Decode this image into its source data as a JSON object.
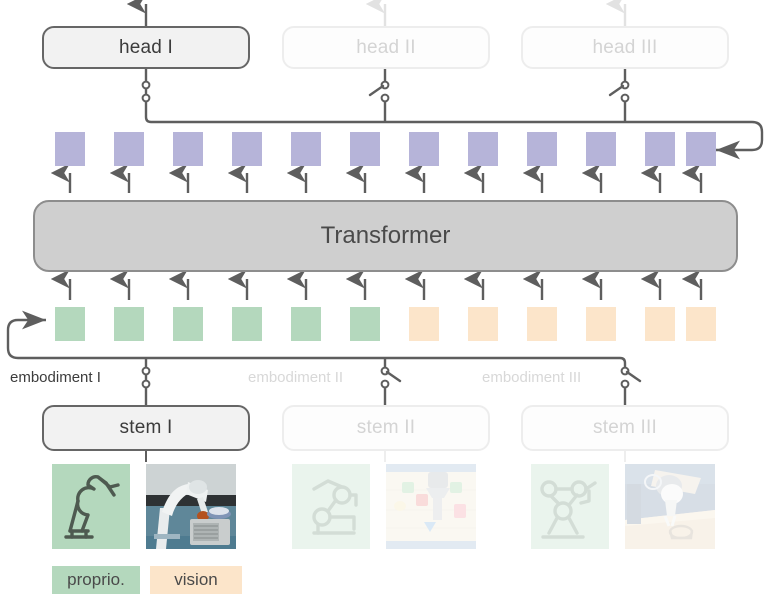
{
  "diagram": {
    "title_hidden": "",
    "core": {
      "label": "Transformer"
    },
    "heads": [
      {
        "label": "head I",
        "state": "active",
        "switch": "closed"
      },
      {
        "label": "head II",
        "state": "inactive",
        "switch": "open"
      },
      {
        "label": "head III",
        "state": "inactive",
        "switch": "open"
      }
    ],
    "stems": [
      {
        "label": "stem I",
        "state": "active",
        "switch": "closed"
      },
      {
        "label": "stem II",
        "state": "inactive",
        "switch": "open"
      },
      {
        "label": "stem III",
        "state": "inactive",
        "switch": "open"
      }
    ],
    "embodiments": [
      {
        "label": "embodiment I",
        "state": "active"
      },
      {
        "label": "embodiment II",
        "state": "inactive"
      },
      {
        "label": "embodiment III",
        "state": "inactive"
      }
    ],
    "output_tokens": {
      "count": 12,
      "color": "#b6b4d9",
      "name": "output token"
    },
    "input_tokens": {
      "proprio_count": 6,
      "vision_count": 6,
      "proprio_color": "#b4d8bd",
      "vision_color": "#fce5ca"
    },
    "legend": [
      {
        "label": "proprio.",
        "color": "#b4d8bd"
      },
      {
        "label": "vision",
        "color": "#fce5ca"
      }
    ],
    "sensor_tiles": [
      {
        "icon": "robot-arm-icon",
        "photo": "robot-arm-photo",
        "state": "active"
      },
      {
        "icon": "robot-arm-icon",
        "photo": "tabletop-blocks-photo",
        "state": "inactive"
      },
      {
        "icon": "robot-arm-icon",
        "photo": "robot-grasp-photo",
        "state": "inactive"
      }
    ],
    "colors": {
      "line": "#5e5e5e",
      "line_dim": "#e6e6e6",
      "transformer_fill": "#cfcfcf",
      "transformer_stroke": "#8d8d8d",
      "module_active_fill": "#f2f2f2",
      "module_active_stroke": "#666666",
      "module_inactive_stroke": "#ededed",
      "text_active": "#3c3c3c",
      "text_inactive": "#d4d4d4"
    }
  }
}
